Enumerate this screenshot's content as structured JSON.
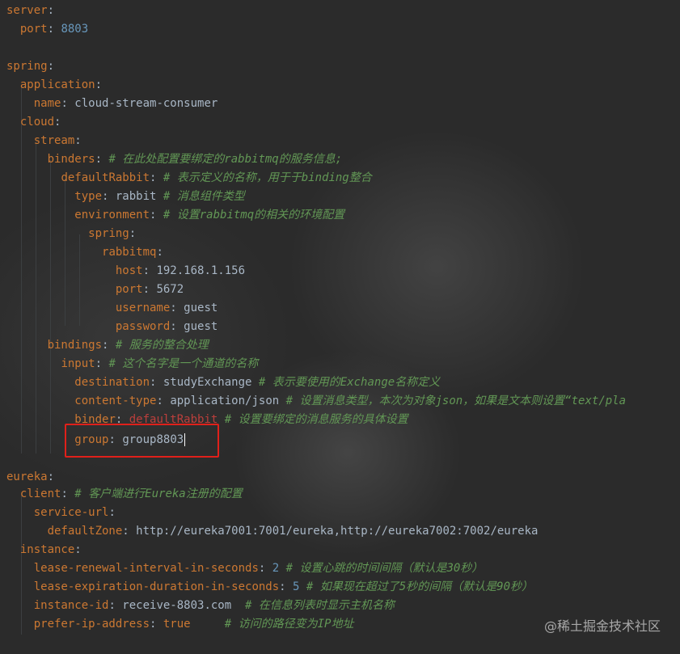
{
  "editor": {
    "lines": {
      "l1": {
        "key": "server",
        "sep": ":"
      },
      "l2": {
        "key": "port",
        "sep": ": ",
        "val": "8803"
      },
      "l4": {
        "key": "spring",
        "sep": ":"
      },
      "l5": {
        "key": "application",
        "sep": ":"
      },
      "l6": {
        "key": "name",
        "sep": ": ",
        "val": "cloud-stream-consumer"
      },
      "l7": {
        "key": "cloud",
        "sep": ":"
      },
      "l8": {
        "key": "stream",
        "sep": ":"
      },
      "l9": {
        "key": "binders",
        "sep": ": ",
        "cmt": "# 在此处配置要绑定的rabbitmq的服务信息;"
      },
      "l10": {
        "key": "defaultRabbit",
        "sep": ": ",
        "cmt": "# 表示定义的名称，用于于binding整合"
      },
      "l11": {
        "key": "type",
        "sep": ": ",
        "val": "rabbit ",
        "cmt": "# 消息组件类型"
      },
      "l12": {
        "key": "environment",
        "sep": ": ",
        "cmt": "# 设置rabbitmq的相关的环境配置"
      },
      "l13": {
        "key": "spring",
        "sep": ":"
      },
      "l14": {
        "key": "rabbitmq",
        "sep": ":"
      },
      "l15": {
        "key": "host",
        "sep": ": ",
        "val": "192.168.1.156"
      },
      "l16": {
        "key": "port",
        "sep": ": ",
        "val": "5672"
      },
      "l17": {
        "key": "username",
        "sep": ": ",
        "val": "guest"
      },
      "l18": {
        "key": "password",
        "sep": ": ",
        "val": "guest"
      },
      "l19": {
        "key": "bindings",
        "sep": ": ",
        "cmt": "# 服务的整合处理"
      },
      "l20": {
        "key": "input",
        "sep": ": ",
        "cmt": "# 这个名字是一个通道的名称"
      },
      "l21": {
        "key": "destination",
        "sep": ": ",
        "val": "studyExchange ",
        "cmt": "# 表示要使用的Exchange名称定义"
      },
      "l22": {
        "key": "content-type",
        "sep": ": ",
        "val": "application/json ",
        "cmt": "# 设置消息类型，本次为对象json，如果是文本则设置“text/pla"
      },
      "l23": {
        "key": "binder",
        "sep": ": ",
        "err": "defaultRabbit",
        "cmt": " # 设置要绑定的消息服务的具体设置"
      },
      "l24": {
        "key": "group",
        "sep": ": ",
        "val": "group8803"
      },
      "l26": {
        "key": "eureka",
        "sep": ":"
      },
      "l27": {
        "key": "client",
        "sep": ": ",
        "cmt": "# 客户端进行Eureka注册的配置"
      },
      "l28": {
        "key": "service-url",
        "sep": ":"
      },
      "l29": {
        "key": "defaultZone",
        "sep": ": ",
        "val": "http://eureka7001:7001/eureka,http://eureka7002:7002/eureka"
      },
      "l30": {
        "key": "instance",
        "sep": ":"
      },
      "l31": {
        "key": "lease-renewal-interval-in-seconds",
        "sep": ": ",
        "val": "2 ",
        "cmt": "# 设置心跳的时间间隔（默认是30秒）"
      },
      "l32": {
        "key": "lease-expiration-duration-in-seconds",
        "sep": ": ",
        "val": "5 ",
        "cmt": "# 如果现在超过了5秒的间隔（默认是90秒）"
      },
      "l33": {
        "key": "instance-id",
        "sep": ": ",
        "val": "receive-8803.com  ",
        "cmt": "# 在信息列表时显示主机名称"
      },
      "l34": {
        "key": "prefer-ip-address",
        "sep": ": ",
        "val": "true     ",
        "cmt": "# 访问的路径变为IP地址"
      }
    }
  },
  "watermark": "@稀土掘金技术社区",
  "colors": {
    "background": "#2b2b2b",
    "key": "#cc7832",
    "number": "#6897bb",
    "comment": "#629755",
    "text": "#a9b7c6",
    "error": "#bc3f3c",
    "highlight_box": "#e0201a"
  }
}
